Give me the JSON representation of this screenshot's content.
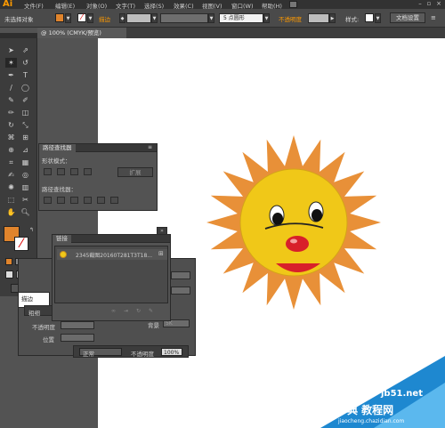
{
  "app": {
    "logo": "Ai"
  },
  "menu": [
    "文件(F)",
    "编辑(E)",
    "对象(O)",
    "文字(T)",
    "选择(S)",
    "效果(C)",
    "视图(V)",
    "窗口(W)",
    "帮助(H)"
  ],
  "control_bar": {
    "selection": "未选择对象",
    "stroke_label": "描边",
    "stroke_value": "",
    "brush_value": "5 点圆形",
    "opacity_label": "不透明度",
    "style_label": "样式:",
    "doc_setup": "文档设置",
    "colors": {
      "fill": "#e0842c",
      "accent": "#ff9a00"
    }
  },
  "doc_tab": {
    "label": "@ 100% (CMYK/预览)",
    "close": "×"
  },
  "pathfinder": {
    "tab": "路径查找器",
    "shape_modes_label": "形状模式：",
    "expand_button": "扩展",
    "pathfinders_label": "路径查找器："
  },
  "links": {
    "tab": "链接",
    "file_name": "2345截图20160T281T3T18..."
  },
  "stroke_panel": {
    "tab": "描边",
    "weight_label": "粗细",
    "opacity_label": "不透明度",
    "position_label": "位置"
  },
  "transparency": {
    "mode_label": "正常",
    "opacity_label": "不透明度",
    "opacity_value": "100%",
    "extra_value": "5K",
    "extra_label": "背景"
  },
  "watermark": {
    "line1": "jb51.net",
    "line2": "查字典 教程网",
    "line3": "jiaocheng.chazidian.com"
  },
  "sun": {
    "face_color": "#f0c818",
    "ray_color": "#e89038",
    "nose_color": "#d8202a",
    "mouth_color": "#d8202a"
  }
}
